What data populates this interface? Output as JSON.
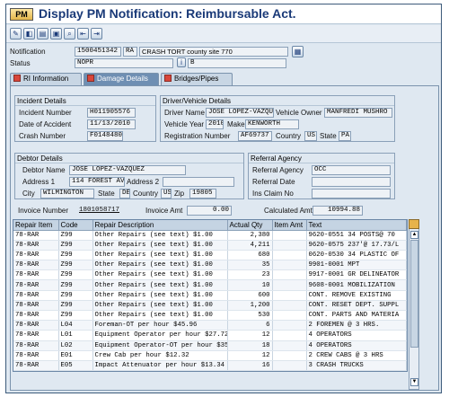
{
  "window": {
    "title": "Display PM Notification: Reimbursable Act.",
    "title_icon": "PM"
  },
  "toolbar": {
    "icons": [
      "edit-icon",
      "display-icon",
      "print-icon",
      "save-icon",
      "find-icon",
      "first-icon",
      "next-icon"
    ]
  },
  "header": {
    "notification_label": "Notification",
    "notification_number": "1500451342",
    "notification_type": "RA",
    "notification_desc": "CRASH TORT county site 770",
    "status_label": "Status",
    "status_value": "NOPR",
    "status_extra": "B"
  },
  "tabs": [
    {
      "label": "RI Information"
    },
    {
      "label": "Damage Details"
    },
    {
      "label": "Bridges/Pipes"
    }
  ],
  "incident": {
    "title": "Incident Details",
    "incident_number_label": "Incident Number",
    "incident_number": "H011905576",
    "date_label": "Date of Accident",
    "date": "11/13/2010",
    "crash_label": "Crash Number",
    "crash": "F0148480"
  },
  "driver": {
    "title": "Driver/Vehicle Details",
    "driver_name_label": "Driver Name",
    "driver_name": "JOSE LOPEZ-VAZQU",
    "owner_label": "Vehicle Owner",
    "owner": "MANFREDI MUSHRO",
    "year_label": "Vehicle Year",
    "year": "2010",
    "make_label": "Make",
    "make": "KENWORTH",
    "reg_label": "Registration Number",
    "reg": "AF69737",
    "country_label": "Country",
    "country": "US",
    "state_label": "State",
    "state": "PA"
  },
  "debtor": {
    "title": "Debtor Details",
    "name_label": "Debtor Name",
    "name": "JOSE LOPEZ-VAZQUEZ",
    "addr1_label": "Address 1",
    "addr1": "114 FOREST AVE",
    "addr2_label": "Address 2",
    "addr2": "",
    "city_label": "City",
    "city": "WILMINGTON",
    "state_label": "State",
    "state": "DE",
    "country_label": "Country",
    "country": "US",
    "zip_label": "Zip",
    "zip": "19805"
  },
  "referral": {
    "title": "Referral Agency",
    "agency_label": "Referral Agency",
    "agency": "OCC",
    "date_label": "Referral Date",
    "date": "",
    "claim_label": "Ins Claim No",
    "claim": ""
  },
  "invoice": {
    "number_label": "Invoice Number",
    "number": "1801058717",
    "amt_label": "Invoice Amt",
    "amt": "0.00",
    "calc_label": "Calculated Amt",
    "calc": "10994.88"
  },
  "table": {
    "columns": [
      "Repair Item",
      "Code",
      "Repair Description",
      "Actual Qty",
      "Item Amt",
      "Text"
    ],
    "rows": [
      [
        "78-RAR",
        "Z99",
        "Other Repairs (see text) $1.00",
        "2,380",
        "",
        "9620-0551 34 POSTS@ 70"
      ],
      [
        "78-RAR",
        "Z99",
        "Other Repairs (see text) $1.00",
        "4,211",
        "",
        "9620-0575 237'@ 17.73/L"
      ],
      [
        "78-RAR",
        "Z99",
        "Other Repairs (see text) $1.00",
        "680",
        "",
        "0620-0530 34 PLASTIC OF"
      ],
      [
        "78-RAR",
        "Z99",
        "Other Repairs (see text) $1.00",
        "35",
        "",
        "9901-0001 MPT"
      ],
      [
        "78-RAR",
        "Z99",
        "Other Repairs (see text) $1.00",
        "23",
        "",
        "9917-0001 GR DELINEATOR"
      ],
      [
        "78-RAR",
        "Z99",
        "Other Repairs (see text) $1.00",
        "10",
        "",
        "9608-0001 MOBILIZATION"
      ],
      [
        "78-RAR",
        "Z99",
        "Other Repairs (see text) $1.00",
        "600",
        "",
        "CONT. REMOVE EXISTING"
      ],
      [
        "78-RAR",
        "Z99",
        "Other Repairs (see text) $1.00",
        "1,200",
        "",
        "CONT. RESET DEPT. SUPPL"
      ],
      [
        "78-RAR",
        "Z99",
        "Other Repairs (see text) $1.00",
        "530",
        "",
        "CONT. PARTS AND MATERIA"
      ],
      [
        "78-RAR",
        "L04",
        "Foreman-OT per hour $45.96",
        "6",
        "",
        "2 FOREMEN @ 3 HRS."
      ],
      [
        "78-RAR",
        "L01",
        "Equipment Operator per hour $27.72",
        "12",
        "",
        "4 OPERATORS"
      ],
      [
        "78-RAR",
        "L02",
        "Equipment Operator-OT per hour $35.62",
        "18",
        "",
        "4 OPERATORS"
      ],
      [
        "78-RAR",
        "E01",
        "Crew Cab per hour $12.32",
        "12",
        "",
        "2 CREW CABS @ 3 HRS"
      ],
      [
        "78-RAR",
        "E05",
        "Impact Attenuator per hour $13.34",
        "16",
        "",
        "3 CRASH TRUCKS"
      ]
    ]
  }
}
